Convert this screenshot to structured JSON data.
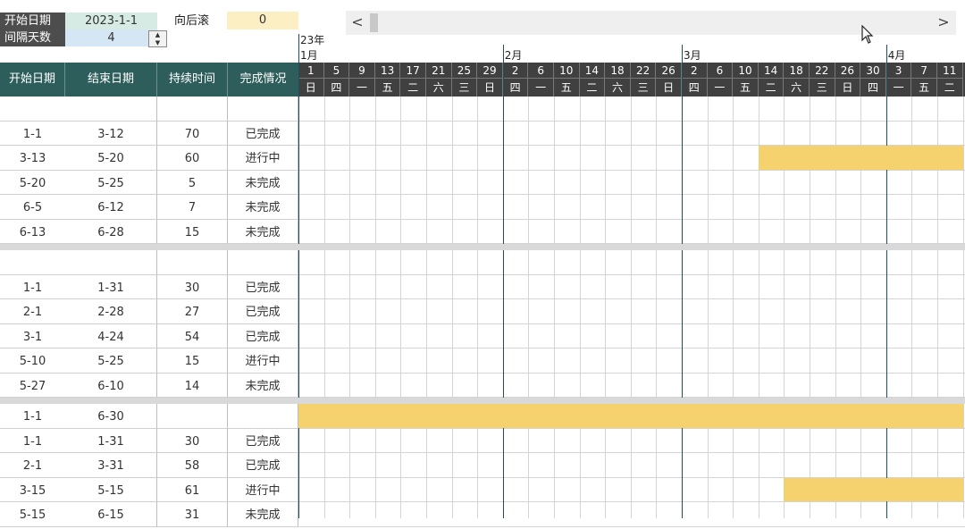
{
  "controls": {
    "start_label": "开始日期",
    "start_value": "2023-1-1",
    "interval_label": "间隔天数",
    "interval_value": "4",
    "scroll_label": "向后滚",
    "scroll_value": "0",
    "scroll_left": "<",
    "scroll_right": ">"
  },
  "columns": [
    "开始日期",
    "结束日期",
    "持续时间",
    "完成情况"
  ],
  "calendar": {
    "year_label": "23年",
    "months": [
      "1月",
      "2月",
      "3月",
      "4月"
    ],
    "days": [
      "1",
      "5",
      "9",
      "13",
      "17",
      "21",
      "25",
      "29",
      "2",
      "6",
      "10",
      "14",
      "18",
      "22",
      "26",
      "2",
      "6",
      "10",
      "14",
      "18",
      "22",
      "26",
      "30",
      "3",
      "7",
      "11"
    ],
    "weekdays": [
      "日",
      "四",
      "一",
      "五",
      "二",
      "六",
      "三",
      "日",
      "四",
      "一",
      "五",
      "二",
      "六",
      "三",
      "日",
      "四",
      "一",
      "五",
      "二",
      "六",
      "三",
      "日",
      "四",
      "一",
      "五",
      "二"
    ]
  },
  "rows": [
    {
      "kind": "blank"
    },
    {
      "kind": "data",
      "start": "1-1",
      "end": "3-12",
      "dur": "70",
      "status": "已完成"
    },
    {
      "kind": "data",
      "start": "3-13",
      "end": "5-20",
      "dur": "60",
      "status": "进行中",
      "bar": [
        18,
        26
      ]
    },
    {
      "kind": "data",
      "start": "5-20",
      "end": "5-25",
      "dur": "5",
      "status": "未完成"
    },
    {
      "kind": "data",
      "start": "6-5",
      "end": "6-12",
      "dur": "7",
      "status": "未完成"
    },
    {
      "kind": "data",
      "start": "6-13",
      "end": "6-28",
      "dur": "15",
      "status": "未完成"
    },
    {
      "kind": "sep"
    },
    {
      "kind": "blank"
    },
    {
      "kind": "data",
      "start": "1-1",
      "end": "1-31",
      "dur": "30",
      "status": "已完成"
    },
    {
      "kind": "data",
      "start": "2-1",
      "end": "2-28",
      "dur": "27",
      "status": "已完成"
    },
    {
      "kind": "data",
      "start": "3-1",
      "end": "4-24",
      "dur": "54",
      "status": "已完成"
    },
    {
      "kind": "data",
      "start": "5-10",
      "end": "5-25",
      "dur": "15",
      "status": "进行中"
    },
    {
      "kind": "data",
      "start": "5-27",
      "end": "6-10",
      "dur": "14",
      "status": "未完成"
    },
    {
      "kind": "sep"
    },
    {
      "kind": "data",
      "start": "1-1",
      "end": "6-30",
      "dur": "",
      "status": "",
      "bar": [
        0,
        26
      ]
    },
    {
      "kind": "data",
      "start": "1-1",
      "end": "1-31",
      "dur": "30",
      "status": "已完成"
    },
    {
      "kind": "data",
      "start": "2-1",
      "end": "3-31",
      "dur": "58",
      "status": "已完成"
    },
    {
      "kind": "data",
      "start": "3-15",
      "end": "5-15",
      "dur": "61",
      "status": "进行中",
      "bar": [
        19,
        26
      ]
    },
    {
      "kind": "data",
      "start": "5-15",
      "end": "6-15",
      "dur": "31",
      "status": "未完成"
    }
  ],
  "colors": {
    "header": "#2e5e5b",
    "bar": "#f5d26e",
    "calendar_header": "#404040",
    "month_line": "#1f4e60"
  },
  "icons": {
    "cursor": "mouse-pointer-icon",
    "spin_up": "spin-up-icon",
    "spin_down": "spin-down-icon"
  }
}
